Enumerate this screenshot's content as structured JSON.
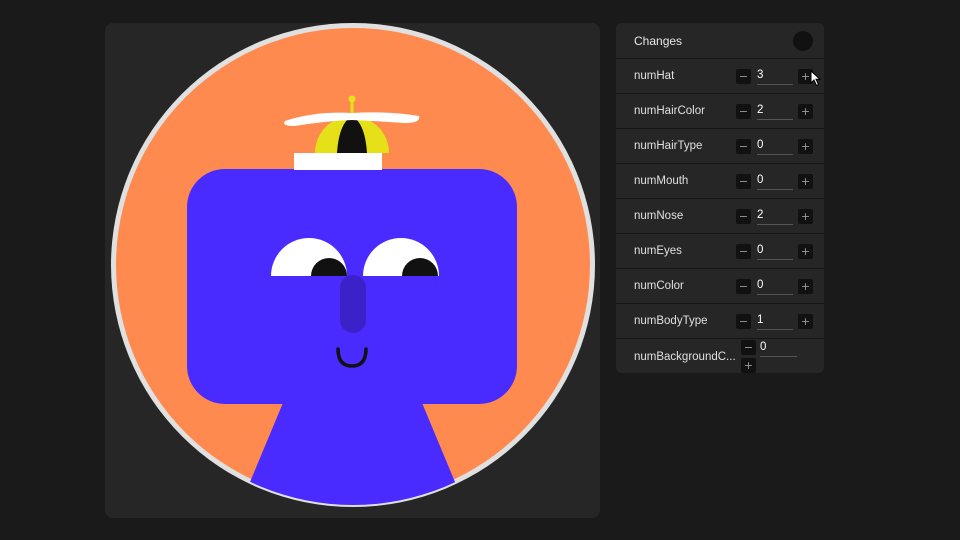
{
  "properties_panel": {
    "title": "Changes",
    "rows": [
      {
        "label": "numHat",
        "value": "3"
      },
      {
        "label": "numHairColor",
        "value": "2"
      },
      {
        "label": "numHairType",
        "value": "0"
      },
      {
        "label": "numMouth",
        "value": "0"
      },
      {
        "label": "numNose",
        "value": "2"
      },
      {
        "label": "numEyes",
        "value": "0"
      },
      {
        "label": "numColor",
        "value": "0"
      },
      {
        "label": "numBodyType",
        "value": "1"
      },
      {
        "label": "numBackgroundC...",
        "value": "0"
      }
    ],
    "minus_glyph": "−",
    "plus_glyph": "+"
  },
  "colors": {
    "background": "#FF8A50",
    "character": "#4A2BFF",
    "hat": "#E6E019",
    "ring": "#E0E0E0"
  },
  "icons": [
    "changes-indicator-icon",
    "pointer-cursor-icon"
  ]
}
